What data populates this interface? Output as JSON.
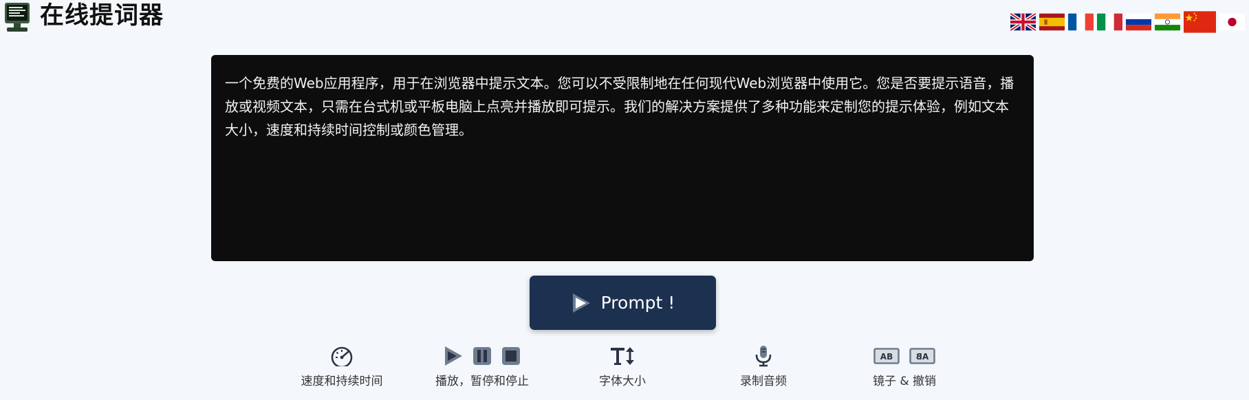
{
  "app": {
    "title": "在线提词器"
  },
  "languages": [
    {
      "code": "en",
      "name": "English"
    },
    {
      "code": "es",
      "name": "Español"
    },
    {
      "code": "fr",
      "name": "Français"
    },
    {
      "code": "it",
      "name": "Italiano"
    },
    {
      "code": "ru",
      "name": "Русский"
    },
    {
      "code": "hi",
      "name": "हिन्दी"
    },
    {
      "code": "zh",
      "name": "中文",
      "selected": true
    },
    {
      "code": "ja",
      "name": "日本語"
    }
  ],
  "editor": {
    "text": "一个免费的Web应用程序，用于在浏览器中提示文本。您可以不受限制地在任何现代Web浏览器中使用它。您是否要提示语音，播放或视频文本，只需在台式机或平板电脑上点亮并播放即可提示。我们的解决方案提供了多种功能来定制您的提示体验，例如文本大小，速度和持续时间控制或颜色管理。"
  },
  "prompt_button": {
    "label": "Prompt !",
    "icon": "play-icon"
  },
  "features": [
    {
      "label": "速度和持续时间",
      "icon": "speedometer-icon"
    },
    {
      "label": "播放，暂停和停止",
      "icon": "play-pause-stop-icons"
    },
    {
      "label": "字体大小",
      "icon": "text-size-icon"
    },
    {
      "label": "录制音频",
      "icon": "microphone-icon"
    },
    {
      "label": "镜子 & 撤销",
      "icon": "mirror-icons"
    }
  ],
  "colors": {
    "background": "#f4f8fc",
    "editor_bg": "#0d0d0d",
    "editor_text": "#f2f2f2",
    "button_bg": "#1c3150",
    "icon_dark": "#2b3445"
  }
}
